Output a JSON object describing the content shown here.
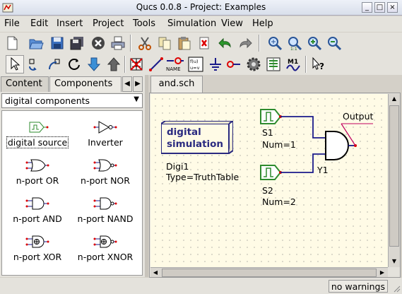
{
  "window": {
    "title": "Qucs 0.0.8 - Project: Examples"
  },
  "menubar": [
    "File",
    "Edit",
    "Insert",
    "Project",
    "Tools",
    "Simulation",
    "View",
    "Help"
  ],
  "toolbar1_icons": [
    "new-file-icon",
    "open-folder-icon",
    "save-icon",
    "save-all-icon",
    "close-icon",
    "print-icon",
    "cut-icon",
    "copy-icon",
    "paste-icon",
    "delete-icon",
    "undo-icon",
    "redo-icon",
    "zoom-fit-icon",
    "zoom-1-1-icon",
    "zoom-in-icon",
    "zoom-out-icon"
  ],
  "toolbar2_icons": [
    "select-arrow-icon",
    "mirror-x-icon",
    "mirror-y-icon",
    "rotate-icon",
    "go-into-icon",
    "go-up-icon",
    "deactivate-icon",
    "wire-icon",
    "label-icon",
    "equation-icon",
    "ground-icon",
    "port-icon",
    "simulate-icon",
    "display-icon",
    "marker-icon",
    "whats-this-icon"
  ],
  "label_icon_text": "NAME",
  "equation_icon_text": "f(u)\nu=v",
  "marker_icon_text": "M1",
  "dock": {
    "tabs": [
      "Content",
      "Components"
    ],
    "category": "digital components",
    "components": [
      {
        "label": "digital source",
        "icon": "digital-source-icon"
      },
      {
        "label": "Inverter",
        "icon": "inverter-icon"
      },
      {
        "label": "n-port OR",
        "icon": "or-gate-icon"
      },
      {
        "label": "n-port NOR",
        "icon": "nor-gate-icon"
      },
      {
        "label": "n-port AND",
        "icon": "and-gate-icon"
      },
      {
        "label": "n-port NAND",
        "icon": "nand-gate-icon"
      },
      {
        "label": "n-port XOR",
        "icon": "xor-gate-icon"
      },
      {
        "label": "n-port XNOR",
        "icon": "xnor-gate-icon"
      }
    ]
  },
  "document": {
    "tab": "and.sch",
    "schematic": {
      "sim_box_line1": "digital",
      "sim_box_line2": "simulation",
      "sim_name": "Digi1",
      "sim_param": "Type=TruthTable",
      "s1_name": "S1",
      "s1_param": "Num=1",
      "s2_name": "S2",
      "s2_param": "Num=2",
      "gate_name": "Y1",
      "output_label": "Output"
    }
  },
  "status": "no warnings",
  "colors": {
    "canvas": "#fffbe6",
    "source_green": "#2e8b2e",
    "wire": "#1a1a8a",
    "port": "#b00000"
  }
}
